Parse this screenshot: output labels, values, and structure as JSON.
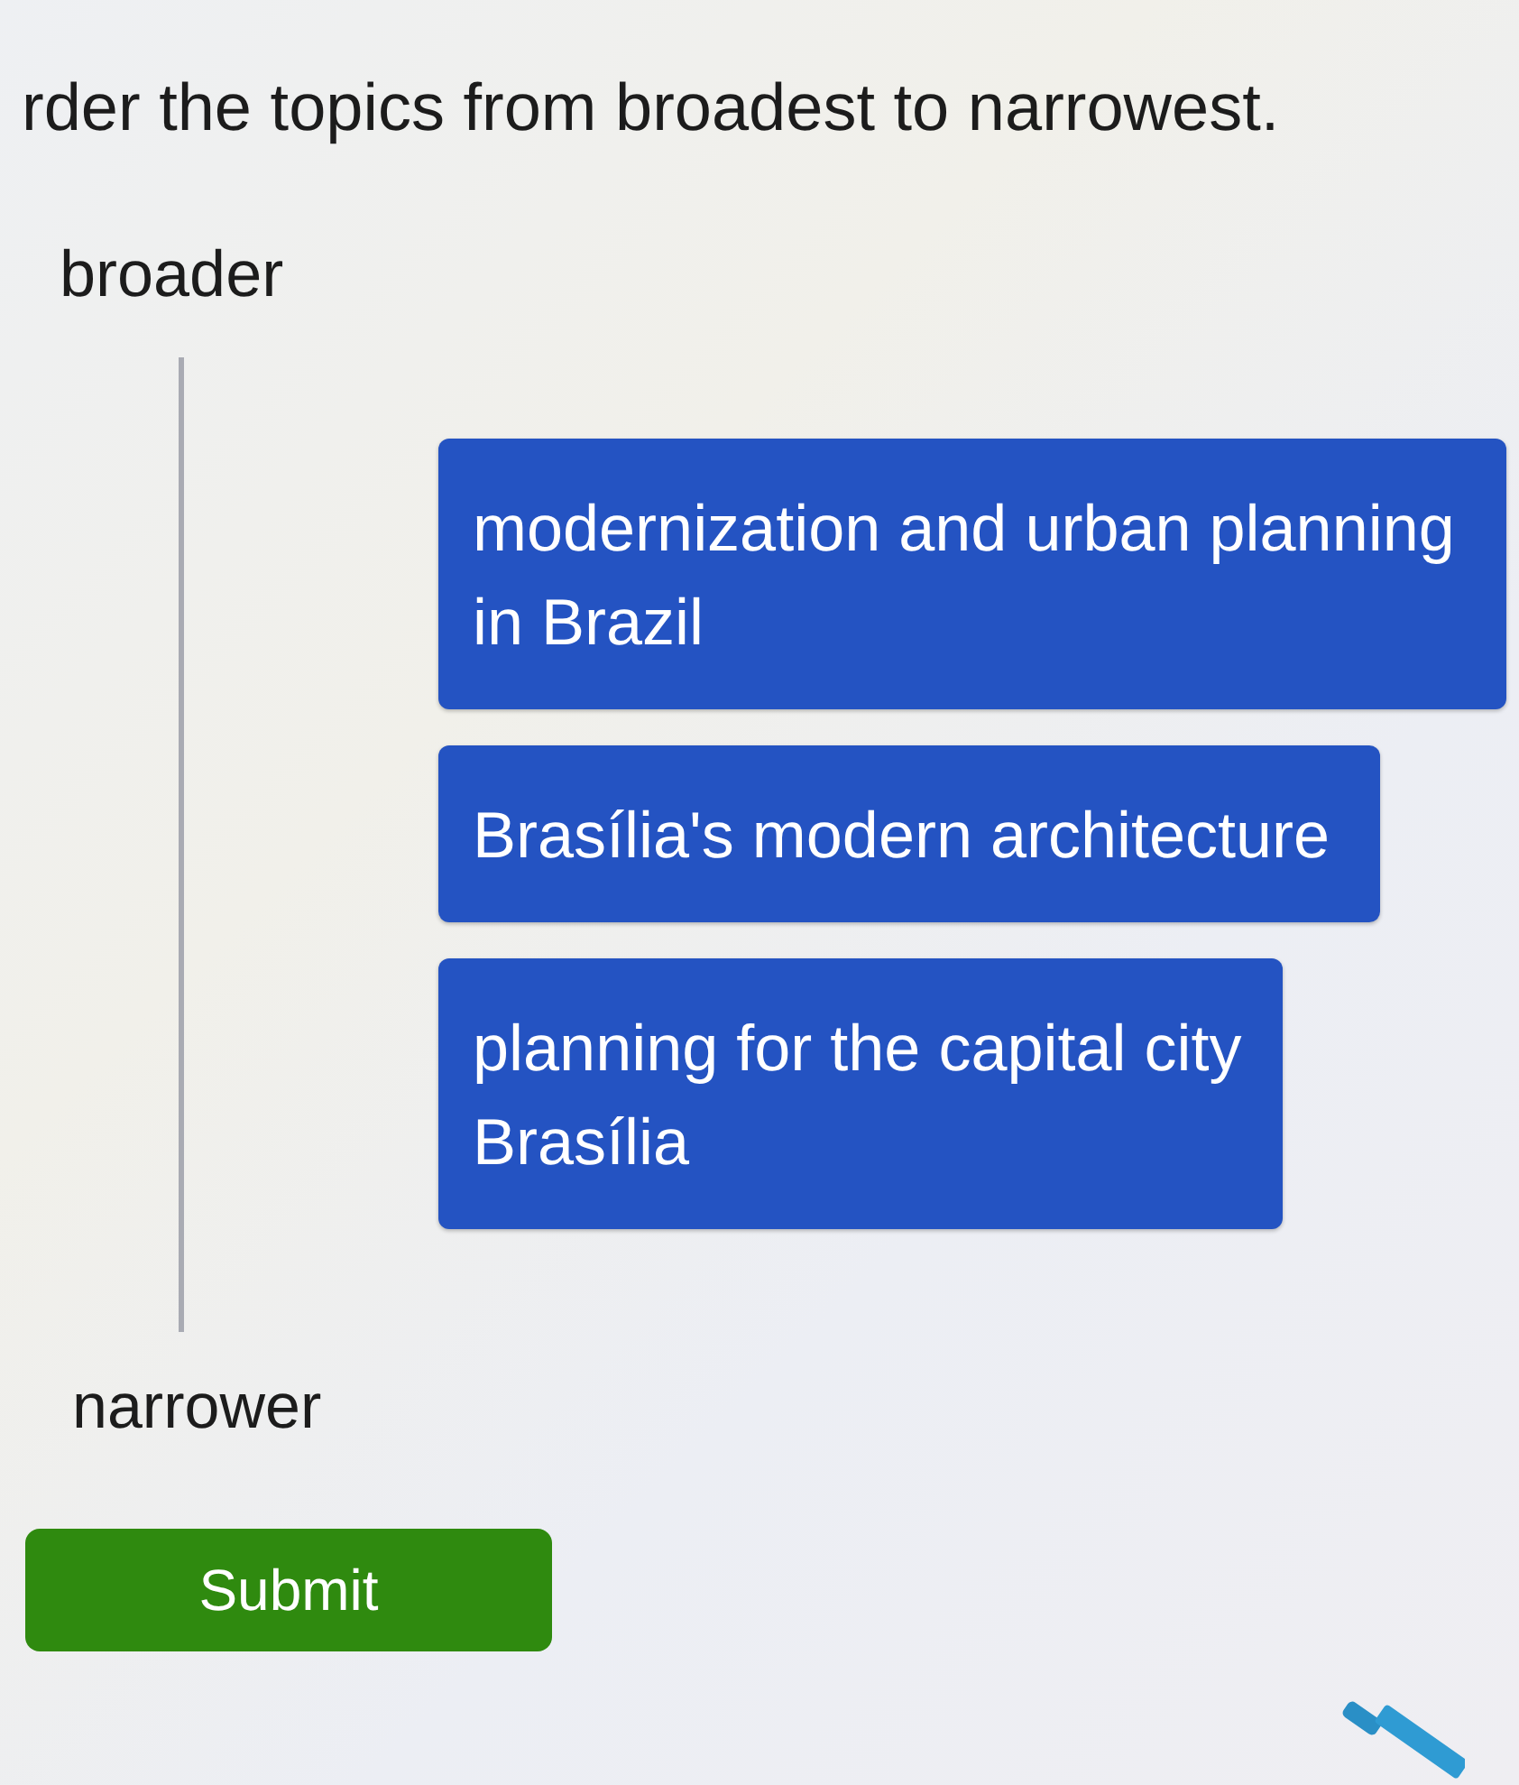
{
  "instruction": "rder the topics from broadest to narrowest.",
  "scale": {
    "top_label": "broader",
    "bottom_label": "narrower"
  },
  "topics": [
    {
      "text": "modernization and urban planning in Brazil"
    },
    {
      "text": "Brasília's modern architecture"
    },
    {
      "text": "planning for the capital city Brasília"
    }
  ],
  "submit_button": {
    "label": "Submit"
  }
}
